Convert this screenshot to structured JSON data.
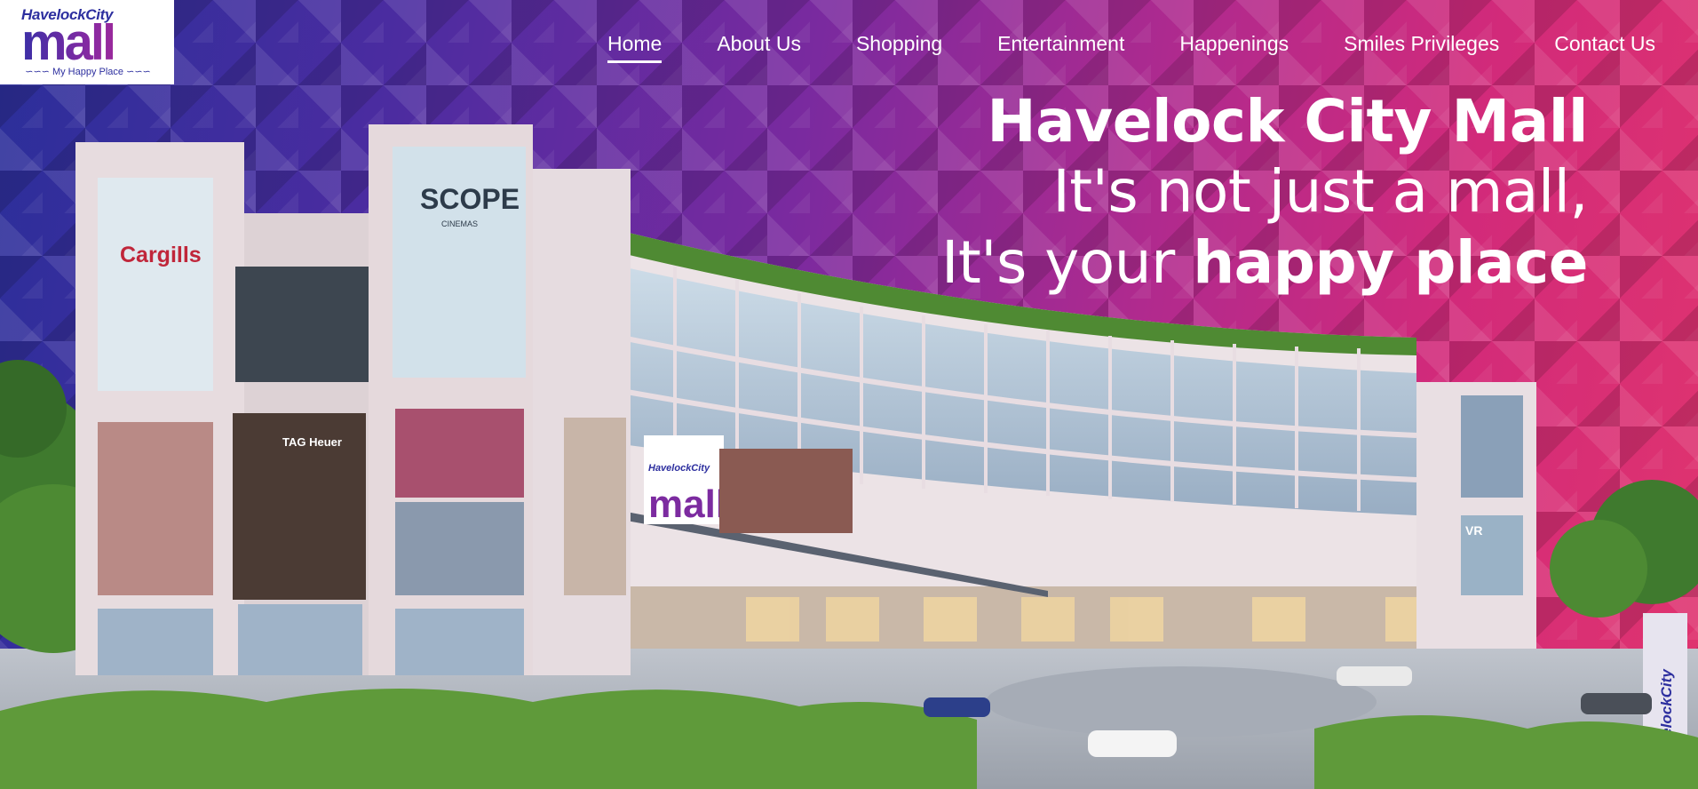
{
  "logo": {
    "top": "HavelockCity",
    "main": "mall",
    "tagline": "My Happy Place"
  },
  "nav": {
    "items": [
      {
        "label": "Home",
        "active": true
      },
      {
        "label": "About Us"
      },
      {
        "label": "Shopping"
      },
      {
        "label": "Entertainment"
      },
      {
        "label": "Happenings"
      },
      {
        "label": "Smiles Privileges"
      },
      {
        "label": "Contact Us"
      }
    ]
  },
  "hero": {
    "title": "Havelock City Mall",
    "line1": "It's not just a mall,",
    "line2_prefix": "It's your ",
    "line2_bold": "happy place"
  },
  "building": {
    "signs": {
      "cargills": "Cargills",
      "scope": "SCOPE",
      "scope_sub": "CINEMAS",
      "mall_small": "HavelockCity",
      "mall_big": "mall",
      "tag": "TAG Heuer",
      "vr": "VR",
      "banner": "HavelockCity"
    }
  },
  "colors": {
    "accent_purple": "#4b2ca0",
    "accent_pink": "#d22a7a",
    "logo_blue": "#2d2f9f"
  }
}
